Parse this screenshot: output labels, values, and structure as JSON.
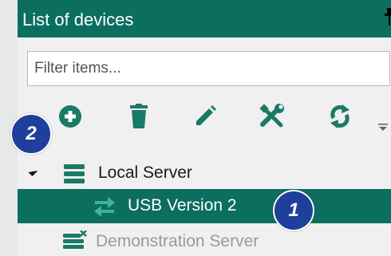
{
  "panel": {
    "title": "List of devices",
    "filter_placeholder": "Filter items..."
  },
  "toolbar": {
    "buttons": [
      {
        "name": "add",
        "icon": "plus-circle-icon"
      },
      {
        "name": "delete",
        "icon": "trash-icon"
      },
      {
        "name": "edit",
        "icon": "pencil-icon"
      },
      {
        "name": "tools",
        "icon": "wrench-screwdriver-icon"
      },
      {
        "name": "refresh",
        "icon": "refresh-icon"
      }
    ]
  },
  "tree": {
    "local_server": "Local Server",
    "usb_version": "USB Version 2",
    "demo_server": "Demonstration Server"
  },
  "badges": {
    "one": "1",
    "two": "2"
  },
  "colors": {
    "accent": "#0b6e5e",
    "icon": "#1a7a66",
    "badge": "#1e3f9c"
  }
}
